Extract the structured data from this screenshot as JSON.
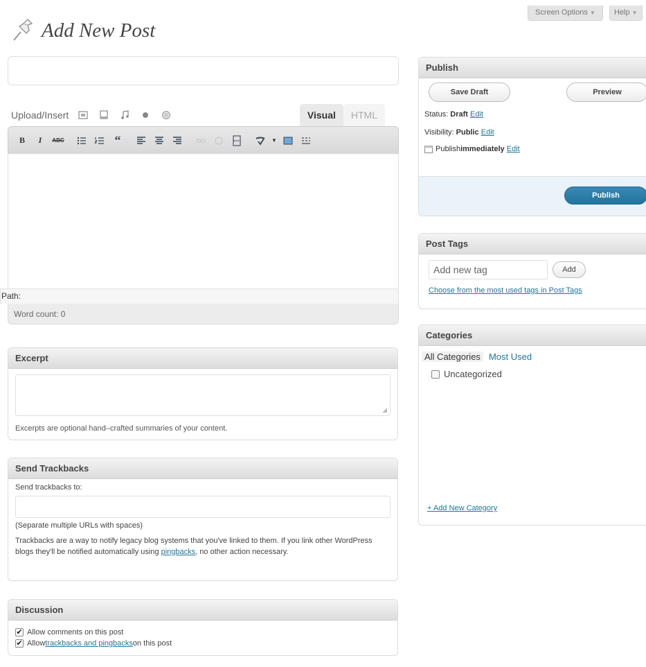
{
  "header": {
    "screen_options": "Screen Options",
    "help": "Help",
    "title": "Add New Post"
  },
  "editor": {
    "title_value": "",
    "upload_insert": "Upload/Insert",
    "tab_visual": "Visual",
    "tab_html": "HTML",
    "path_label": "Path:",
    "word_count": "Word count: 0"
  },
  "excerpt": {
    "title": "Excerpt",
    "hint": "Excerpts are optional hand–crafted summaries of your content."
  },
  "trackbacks": {
    "title": "Send Trackbacks",
    "label": "Send trackbacks to:",
    "separate_hint": "(Separate multiple URLs with spaces)",
    "description_before": "Trackbacks are a way to notify legacy blog systems that you've linked to them. If you link other WordPress blogs they'll be notified automatically using ",
    "pingbacks_link": "pingbacks",
    "description_after": ", no other action necessary."
  },
  "discussion": {
    "title": "Discussion",
    "allow_comments": "Allow comments on this post",
    "allow_prefix": "Allow ",
    "trackbacks_link": "trackbacks and pingbacks",
    "allow_suffix": " on this post"
  },
  "publish": {
    "title": "Publish",
    "save_draft": "Save Draft",
    "preview": "Preview",
    "status_label": "Status: ",
    "status_value": "Draft",
    "visibility_label": "Visibility: ",
    "visibility_value": "Public",
    "edit": "Edit",
    "publish_label": "Publish ",
    "publish_when": "immediately",
    "publish_button": "Publish"
  },
  "tags": {
    "title": "Post Tags",
    "placeholder": "Add new tag",
    "add_button": "Add",
    "choose_link": "Choose from the most used tags in Post Tags"
  },
  "categories": {
    "title": "Categories",
    "tab_all": "All Categories",
    "tab_most_used": "Most Used",
    "items": [
      "Uncategorized"
    ],
    "add_new": "+ Add New Category"
  },
  "colors": {
    "link": "#21759b",
    "primary": "#21759b"
  }
}
